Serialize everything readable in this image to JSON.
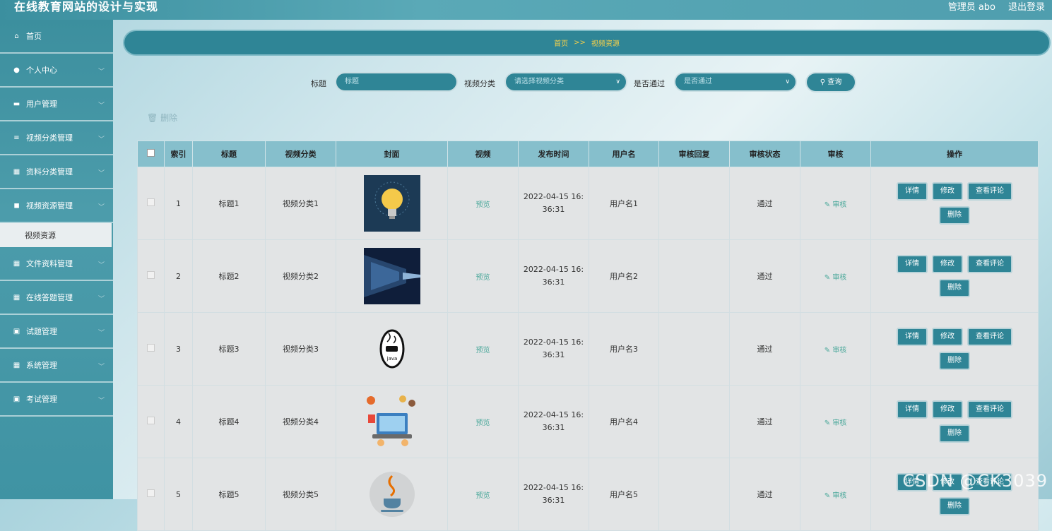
{
  "header": {
    "title": "在线教育网站的设计与实现",
    "admin": "管理员 abo",
    "logout": "退出登录"
  },
  "sidebar": {
    "items": [
      {
        "label": "首页",
        "icon": "home-icon",
        "glyph": "⌂"
      },
      {
        "label": "个人中心",
        "icon": "user-icon",
        "glyph": "●"
      },
      {
        "label": "用户管理",
        "icon": "monitor-icon",
        "glyph": "▬"
      },
      {
        "label": "视频分类管理",
        "icon": "sliders-icon",
        "glyph": "≡"
      },
      {
        "label": "资料分类管理",
        "icon": "grid-icon",
        "glyph": "▦"
      },
      {
        "label": "视频资源管理",
        "icon": "video-icon",
        "glyph": "◼"
      },
      {
        "label": "文件资料管理",
        "icon": "grid-icon",
        "glyph": "▦"
      },
      {
        "label": "在线答题管理",
        "icon": "table-icon",
        "glyph": "▦"
      },
      {
        "label": "试题管理",
        "icon": "clipboard-icon",
        "glyph": "▣"
      },
      {
        "label": "系统管理",
        "icon": "grid-icon",
        "glyph": "▦"
      },
      {
        "label": "考试管理",
        "icon": "clipboard-icon",
        "glyph": "▣"
      }
    ],
    "submenu": "视频资源"
  },
  "breadcrumb": {
    "home": "首页",
    "sep": ">>",
    "current": "视频资源"
  },
  "search": {
    "title_label": "标题",
    "title_placeholder": "标题",
    "category_label": "视频分类",
    "category_placeholder": "请选择视频分类",
    "pass_label": "是否通过",
    "pass_placeholder": "是否通过",
    "query_button": "查询"
  },
  "delete_top": "删除",
  "table": {
    "headers": [
      "",
      "索引",
      "标题",
      "视频分类",
      "封面",
      "视频",
      "发布时间",
      "用户名",
      "审核回复",
      "审核状态",
      "审核",
      "操作"
    ],
    "rows": [
      {
        "index": "1",
        "title": "标题1",
        "category": "视频分类1",
        "preview": "预览",
        "time1": "2022-04-15 16:",
        "time2": "36:31",
        "user": "用户名1",
        "reply": "",
        "status": "通过",
        "audit": "审核"
      },
      {
        "index": "2",
        "title": "标题2",
        "category": "视频分类2",
        "preview": "预览",
        "time1": "2022-04-15 16:",
        "time2": "36:31",
        "user": "用户名2",
        "reply": "",
        "status": "通过",
        "audit": "审核"
      },
      {
        "index": "3",
        "title": "标题3",
        "category": "视频分类3",
        "preview": "预览",
        "time1": "2022-04-15 16:",
        "time2": "36:31",
        "user": "用户名3",
        "reply": "",
        "status": "通过",
        "audit": "审核"
      },
      {
        "index": "4",
        "title": "标题4",
        "category": "视频分类4",
        "preview": "预览",
        "time1": "2022-04-15 16:",
        "time2": "36:31",
        "user": "用户名4",
        "reply": "",
        "status": "通过",
        "audit": "审核"
      },
      {
        "index": "5",
        "title": "标题5",
        "category": "视频分类5",
        "preview": "预览",
        "time1": "2022-04-15 16:",
        "time2": "36:31",
        "user": "用户名5",
        "reply": "",
        "status": "通过",
        "audit": "审核"
      }
    ],
    "ops": {
      "detail": "详情",
      "edit": "修改",
      "comments": "查看评论",
      "delete": "删除"
    }
  },
  "watermark": "CSDN @CK3039",
  "colors": {
    "accent": "#2f8596",
    "breadcrumb_text": "#f5d04a",
    "header_row": "#86bfcc",
    "link": "#4aa89a"
  }
}
